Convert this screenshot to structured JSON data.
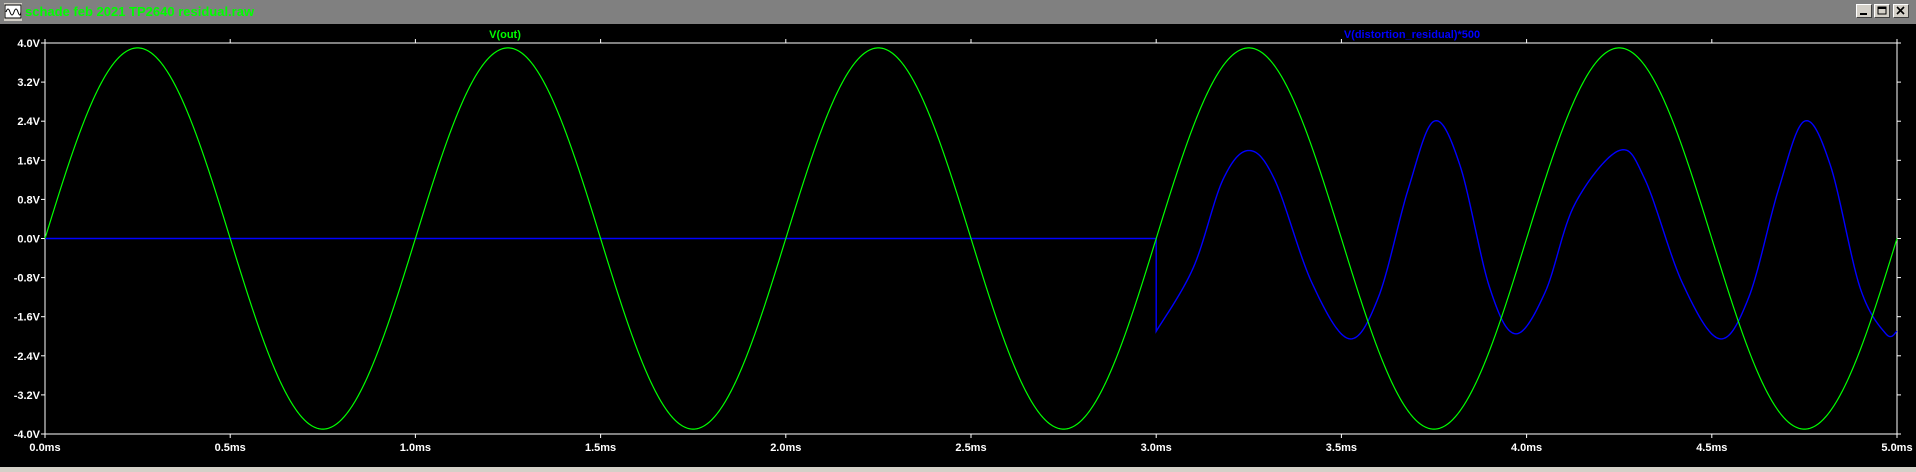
{
  "window": {
    "title": "schade feb 2021 TP2640 residual.raw"
  },
  "chart_data": {
    "type": "line",
    "xlabel": "",
    "ylabel": "",
    "xlim": [
      0.0,
      5.0
    ],
    "ylim": [
      -4.0,
      4.0
    ],
    "x_unit": "ms",
    "y_unit": "V",
    "grid": false,
    "x_ticks": [
      "0.0ms",
      "0.5ms",
      "1.0ms",
      "1.5ms",
      "2.0ms",
      "2.5ms",
      "3.0ms",
      "3.5ms",
      "4.0ms",
      "4.5ms",
      "5.0ms"
    ],
    "x_tick_values": [
      0.0,
      0.5,
      1.0,
      1.5,
      2.0,
      2.5,
      3.0,
      3.5,
      4.0,
      4.5,
      5.0
    ],
    "y_ticks": [
      "4.0V",
      "3.2V",
      "2.4V",
      "1.6V",
      "0.8V",
      "0.0V",
      "-0.8V",
      "-1.6V",
      "-2.4V",
      "-3.2V",
      "-4.0V"
    ],
    "y_tick_values": [
      4.0,
      3.2,
      2.4,
      1.6,
      0.8,
      0.0,
      -0.8,
      -1.6,
      -2.4,
      -3.2,
      -4.0
    ],
    "series": [
      {
        "name": "V(out)",
        "color": "#00ff00",
        "description": "sine wave, amplitude 3.9V, frequency 1kHz (period 1ms), starting at 0V rising",
        "amplitude": 3.9,
        "period_ms": 1.0,
        "points": [
          [
            0.0,
            0.0
          ],
          [
            0.125,
            2.76
          ],
          [
            0.25,
            3.9
          ],
          [
            0.375,
            2.76
          ],
          [
            0.5,
            0.0
          ],
          [
            0.625,
            -2.76
          ],
          [
            0.75,
            -3.9
          ],
          [
            0.875,
            -2.76
          ],
          [
            1.0,
            0.0
          ],
          [
            1.25,
            3.9
          ],
          [
            1.5,
            0.0
          ],
          [
            1.75,
            -3.9
          ],
          [
            2.0,
            0.0
          ],
          [
            2.25,
            3.9
          ],
          [
            2.5,
            0.0
          ],
          [
            2.75,
            -3.9
          ],
          [
            3.0,
            0.0
          ],
          [
            3.25,
            3.9
          ],
          [
            3.5,
            0.0
          ],
          [
            3.75,
            -3.9
          ],
          [
            4.0,
            0.0
          ],
          [
            4.25,
            3.9
          ],
          [
            4.5,
            0.0
          ],
          [
            4.75,
            -3.9
          ],
          [
            5.0,
            0.0
          ]
        ]
      },
      {
        "name": "V(distortion_residual)*500",
        "color": "#0000ff",
        "description": "0V flat until 3.0ms, then steps to about -1.9V and follows a distorted periodic waveform with peaks ~1.8V at 3.25ms/4.25ms, ~2.4V at 3.75ms/4.75ms, minima ~-2.0V near 3.52ms, 3.97ms, 4.52ms, 4.97ms",
        "points": [
          [
            0.0,
            0.0
          ],
          [
            3.0,
            0.0
          ],
          [
            3.0,
            -1.9
          ],
          [
            3.1,
            -0.6
          ],
          [
            3.18,
            1.2
          ],
          [
            3.25,
            1.8
          ],
          [
            3.32,
            1.2
          ],
          [
            3.42,
            -0.9
          ],
          [
            3.52,
            -2.05
          ],
          [
            3.6,
            -1.2
          ],
          [
            3.68,
            1.0
          ],
          [
            3.75,
            2.4
          ],
          [
            3.82,
            1.5
          ],
          [
            3.9,
            -1.0
          ],
          [
            3.97,
            -1.95
          ],
          [
            4.05,
            -1.1
          ],
          [
            4.13,
            0.7
          ],
          [
            4.25,
            1.8
          ],
          [
            4.32,
            1.2
          ],
          [
            4.42,
            -0.9
          ],
          [
            4.52,
            -2.05
          ],
          [
            4.6,
            -1.2
          ],
          [
            4.68,
            1.0
          ],
          [
            4.75,
            2.4
          ],
          [
            4.82,
            1.5
          ],
          [
            4.9,
            -1.0
          ],
          [
            4.97,
            -1.95
          ],
          [
            5.0,
            -1.9
          ]
        ]
      }
    ]
  },
  "colors": {
    "background": "#000000",
    "axis": "#ffffff",
    "tick_text": "#ffffff",
    "titlebar": "#808080",
    "title_text": "#00ff00"
  },
  "icons": {
    "app": "waveform-icon",
    "minimize": "minimize-icon",
    "maximize": "maximize-icon",
    "close": "close-icon"
  }
}
